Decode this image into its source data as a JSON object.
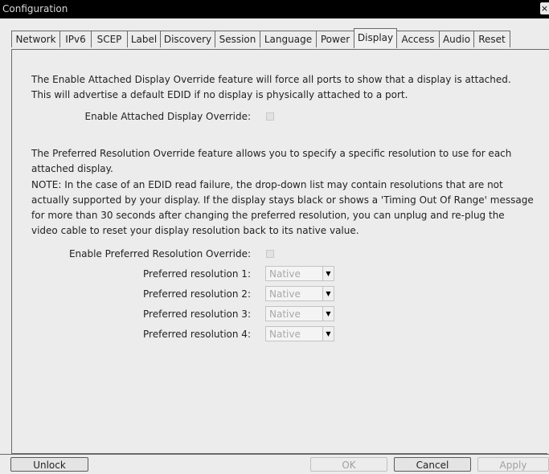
{
  "window": {
    "title": "Configuration",
    "close_glyph": "×"
  },
  "tabs": [
    {
      "label": "Network"
    },
    {
      "label": "IPv6"
    },
    {
      "label": "SCEP"
    },
    {
      "label": "Label"
    },
    {
      "label": "Discovery"
    },
    {
      "label": "Session"
    },
    {
      "label": "Language"
    },
    {
      "label": "Power"
    },
    {
      "label": "Display",
      "active": true
    },
    {
      "label": "Access"
    },
    {
      "label": "Audio"
    },
    {
      "label": "Reset"
    }
  ],
  "display": {
    "attached_desc": "The Enable Attached Display Override feature will force all ports to show that a display is attached. This will advertise a default EDID if no display is physically attached to a port.",
    "attached_label": "Enable Attached Display Override:",
    "attached_checked": false,
    "preferred_desc": "The Preferred Resolution Override feature allows you to specify a specific resolution to use for each attached display.",
    "note": "NOTE: In the case of an EDID read failure, the drop-down list may contain resolutions that are not actually supported by your display. If the display stays black or shows a 'Timing Out Of Range' message for more than 30 seconds after changing the preferred resolution, you can unplug and re-plug the video cable to reset your display resolution back to its native value.",
    "preferred_label": "Enable Preferred Resolution Override:",
    "preferred_checked": false,
    "resolutions": [
      {
        "label": "Preferred resolution 1:",
        "value": "Native"
      },
      {
        "label": "Preferred resolution 2:",
        "value": "Native"
      },
      {
        "label": "Preferred resolution 3:",
        "value": "Native"
      },
      {
        "label": "Preferred resolution 4:",
        "value": "Native"
      }
    ]
  },
  "buttons": {
    "unlock": "Unlock",
    "ok": "OK",
    "cancel": "Cancel",
    "apply": "Apply"
  },
  "icons": {
    "dropdown": "chevron-down-icon",
    "close": "close-icon"
  }
}
